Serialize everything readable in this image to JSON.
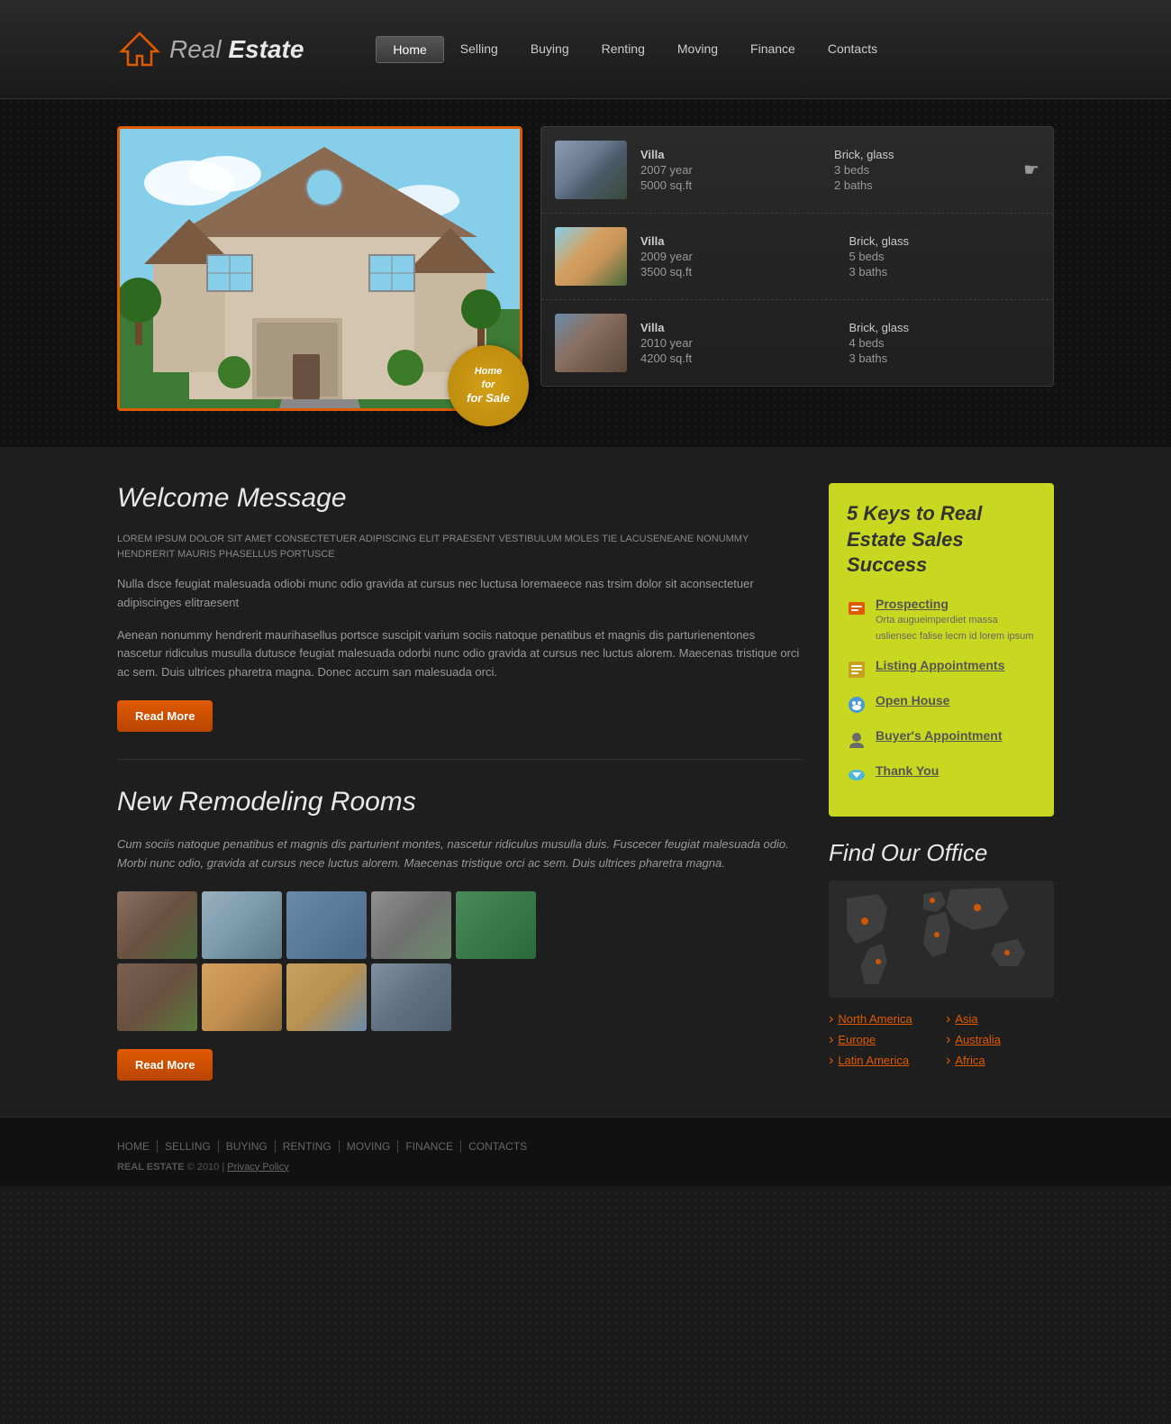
{
  "site": {
    "name": "Real Estate",
    "logo_real": "Real",
    "logo_estate": "Estate"
  },
  "nav": {
    "items": [
      {
        "label": "Home",
        "active": true
      },
      {
        "label": "Selling",
        "active": false
      },
      {
        "label": "Buying",
        "active": false
      },
      {
        "label": "Renting",
        "active": false
      },
      {
        "label": "Moving",
        "active": false
      },
      {
        "label": "Finance",
        "active": false
      },
      {
        "label": "Contacts",
        "active": false
      }
    ]
  },
  "sale_badge": {
    "line1": "Home",
    "line2": "for Sale"
  },
  "listings": [
    {
      "type": "Villa",
      "year": "2007 year",
      "size": "5000 sq.ft",
      "material": "Brick, glass",
      "beds": "3 beds",
      "baths": "2 baths"
    },
    {
      "type": "Villa",
      "year": "2009 year",
      "size": "3500 sq.ft",
      "material": "Brick, glass",
      "beds": "5 beds",
      "baths": "3 baths"
    },
    {
      "type": "Villa",
      "year": "2010 year",
      "size": "4200 sq.ft",
      "material": "Brick, glass",
      "beds": "4 beds",
      "baths": "3 baths"
    }
  ],
  "welcome": {
    "title": "Welcome Message",
    "lead": "LOREM IPSUM DOLOR SIT AMET CONSECTETUER ADIPISCING ELIT PRAESENT VESTIBULUM MOLES TIE LACUSENEANE NONUMMY HENDRERIT MAURIS PHASELLUS PORTUSCE",
    "body1": "Nulla dsce feugiat malesuada odiobi munc odio gravida at cursus nec luctusa loremaeece nas trsim dolor sit aconsectetuer adipiscinges elitraesent",
    "body2": "Aenean nonummy hendrerit maurihasellus portsce suscipit varium sociis natoque penatibus et magnis dis parturienentones nascetur ridiculus musulla dutusce feugiat malesuada odorbi nunc odio gravida at cursus nec luctus alorem. Maecenas tristique orci ac sem. Duis ultrices pharetra magna. Donec accum san malesuada orci.",
    "read_more": "Read More"
  },
  "remodeling": {
    "title": "New Remodeling Rooms",
    "lead": "Cum sociis natoque penatibus et magnis dis parturient montes, nascetur ridiculus musulla duis. Fuscecer feugiat malesuada odio. Morbi nunc odio, gravida at cursus nece luctus alorem. Maecenas tristique orci ac sem. Duis ultrices pharetra magna.",
    "read_more": "Read More"
  },
  "keys": {
    "title": "5 Keys to Real Estate Sales Success",
    "items": [
      {
        "label": "Prospecting",
        "desc": "Orta augueimperdiet massa usliensec falise lecm id lorem ipsum",
        "icon_color": "#e05a00"
      },
      {
        "label": "Listing Appointments",
        "desc": "",
        "icon_color": "#c8a020"
      },
      {
        "label": "Open House",
        "desc": "",
        "icon_color": "#4a9ad4"
      },
      {
        "label": "Buyer's Appointment",
        "desc": "",
        "icon_color": "#6a6a6a"
      },
      {
        "label": "Thank You",
        "desc": "",
        "icon_color": "#4ab8d8"
      }
    ]
  },
  "office": {
    "title": "Find Our Office",
    "regions": [
      {
        "label": "North America",
        "col": 1
      },
      {
        "label": "Asia",
        "col": 2
      },
      {
        "label": "Europe",
        "col": 1
      },
      {
        "label": "Australia",
        "col": 2
      },
      {
        "label": "Latin America",
        "col": 1
      },
      {
        "label": "Africa",
        "col": 2
      }
    ]
  },
  "footer": {
    "nav_items": [
      {
        "label": "HOME"
      },
      {
        "label": "SELLING"
      },
      {
        "label": "BUYING"
      },
      {
        "label": "RENTING"
      },
      {
        "label": "MOVING"
      },
      {
        "label": "FINANCE"
      },
      {
        "label": "CONTACTS"
      }
    ],
    "copy": "REAL ESTATE",
    "year": "© 2010",
    "privacy": "Privacy Policy"
  }
}
